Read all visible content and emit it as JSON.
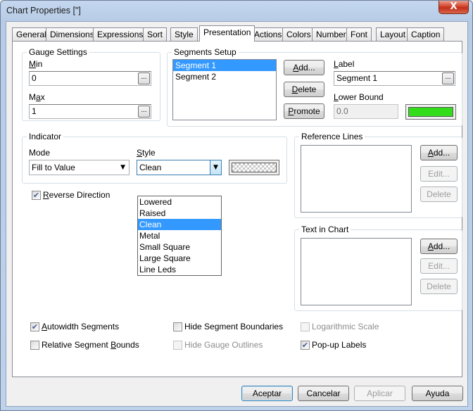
{
  "window": {
    "title": "Chart Properties [\"]",
    "close_label": "X"
  },
  "tabs": [
    {
      "label": "General"
    },
    {
      "label": "Dimensions"
    },
    {
      "label": "Expressions"
    },
    {
      "label": "Sort"
    },
    {
      "label": "Style"
    },
    {
      "label": "Presentation"
    },
    {
      "label": "Actions"
    },
    {
      "label": "Colors"
    },
    {
      "label": "Number"
    },
    {
      "label": "Font"
    },
    {
      "label": "Layout"
    },
    {
      "label": "Caption"
    }
  ],
  "gauge_settings": {
    "title": "Gauge Settings",
    "min_label": "Min",
    "min_value": "0",
    "max_label": "Max",
    "max_value": "1",
    "ellipsis": "..."
  },
  "segments_setup": {
    "title": "Segments Setup",
    "segments": [
      "Segment 1",
      "Segment 2"
    ],
    "add_button": "Add...",
    "delete_button": "Delete",
    "promote_button": "Promote",
    "label_caption": "Label",
    "label_value": "Segment 1",
    "lower_bound_caption": "Lower Bound",
    "lower_bound_value": "0.0",
    "segment_color": "#33dd1a"
  },
  "indicator": {
    "title": "Indicator",
    "mode_label": "Mode",
    "mode_value": "Fill to Value",
    "style_label": "Style",
    "style_value": "Clean",
    "style_options": [
      "Lowered",
      "Raised",
      "Clean",
      "Metal",
      "Small Square",
      "Large Square",
      "Line Leds"
    ],
    "selected_option": "Clean"
  },
  "reverse_direction": {
    "label": "Reverse Direction",
    "checked": true
  },
  "reference_lines": {
    "title": "Reference Lines",
    "add_button": "Add...",
    "edit_button": "Edit...",
    "delete_button": "Delete"
  },
  "text_in_chart": {
    "title": "Text in Chart",
    "add_button": "Add...",
    "edit_button": "Edit...",
    "delete_button": "Delete"
  },
  "options": {
    "autowidth_segments": {
      "label": "Autowidth Segments",
      "checked": true
    },
    "relative_segment_bounds": {
      "label": "Relative Segment Bounds",
      "checked": false
    },
    "hide_segment_boundaries": {
      "label": "Hide Segment Boundaries",
      "checked": false
    },
    "hide_gauge_outlines": {
      "label": "Hide Gauge Outlines",
      "checked": false
    },
    "logarithmic_scale": {
      "label": "Logarithmic Scale",
      "checked": false
    },
    "popup_labels": {
      "label": "Pop-up Labels",
      "checked": true
    }
  },
  "footer": {
    "accept": "Aceptar",
    "cancel": "Cancelar",
    "apply": "Aplicar",
    "help": "Ayuda"
  }
}
